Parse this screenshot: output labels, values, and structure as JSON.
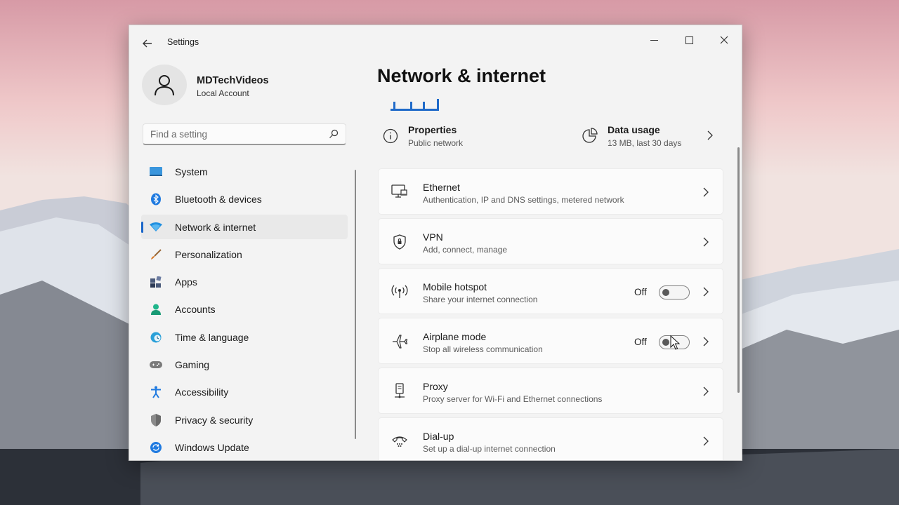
{
  "window": {
    "app_title": "Settings"
  },
  "profile": {
    "name": "MDTechVideos",
    "account_type": "Local Account"
  },
  "search": {
    "placeholder": "Find a setting"
  },
  "sidebar": {
    "items": [
      {
        "label": "System",
        "icon": "monitor-icon",
        "color": "#3a96dd"
      },
      {
        "label": "Bluetooth & devices",
        "icon": "bluetooth-icon",
        "color": "#1f7ae0"
      },
      {
        "label": "Network & internet",
        "icon": "wifi-icon",
        "color": "#1e8fe0",
        "active": true
      },
      {
        "label": "Personalization",
        "icon": "brush-icon",
        "color": "#d87a2a"
      },
      {
        "label": "Apps",
        "icon": "apps-icon",
        "color": "#4a5a7a"
      },
      {
        "label": "Accounts",
        "icon": "person-icon",
        "color": "#1fb58a"
      },
      {
        "label": "Time & language",
        "icon": "globe-clock-icon",
        "color": "#2aa0d8"
      },
      {
        "label": "Gaming",
        "icon": "gamepad-icon",
        "color": "#7a7a7a"
      },
      {
        "label": "Accessibility",
        "icon": "accessibility-icon",
        "color": "#1f7ae0"
      },
      {
        "label": "Privacy & security",
        "icon": "shield-icon",
        "color": "#7a7a7a"
      },
      {
        "label": "Windows Update",
        "icon": "update-icon",
        "color": "#1f7ae0"
      }
    ]
  },
  "main": {
    "title": "Network & internet",
    "properties": {
      "title": "Properties",
      "subtitle": "Public network"
    },
    "data_usage": {
      "title": "Data usage",
      "subtitle": "13 MB, last 30 days"
    },
    "cards": [
      {
        "title": "Ethernet",
        "subtitle": "Authentication, IP and DNS settings, metered network",
        "icon": "ethernet-icon"
      },
      {
        "title": "VPN",
        "subtitle": "Add, connect, manage",
        "icon": "vpn-shield-icon"
      },
      {
        "title": "Mobile hotspot",
        "subtitle": "Share your internet connection",
        "icon": "hotspot-icon",
        "toggle": "Off"
      },
      {
        "title": "Airplane mode",
        "subtitle": "Stop all wireless communication",
        "icon": "airplane-icon",
        "toggle": "Off"
      },
      {
        "title": "Proxy",
        "subtitle": "Proxy server for Wi-Fi and Ethernet connections",
        "icon": "proxy-icon"
      },
      {
        "title": "Dial-up",
        "subtitle": "Set up a dial-up internet connection",
        "icon": "dialup-icon"
      }
    ]
  }
}
